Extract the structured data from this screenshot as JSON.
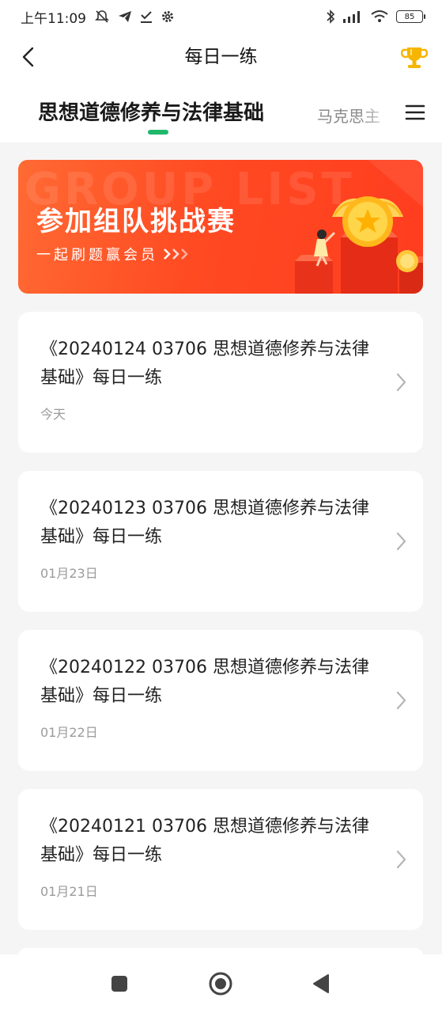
{
  "status_bar": {
    "time": "上午11:09",
    "battery": "85",
    "icons": [
      "alarm-off-icon",
      "telegram-icon",
      "download-check-icon",
      "settings-gear-icon",
      "bluetooth-icon",
      "signal-icon",
      "wifi-icon",
      "battery-icon"
    ]
  },
  "header": {
    "title": "每日一练",
    "back_icon": "chevron-left-icon",
    "trophy_icon": "trophy-icon"
  },
  "tabs": {
    "items": [
      {
        "label": "思想道德修养与法律基础",
        "active": true
      },
      {
        "label": "马克思主",
        "active": false
      }
    ],
    "menu_icon": "menu-icon",
    "accent_color": "#1fb86b"
  },
  "banner": {
    "title": "参加组队挑战赛",
    "subtitle": "一起刷题赢会员",
    "background_text": "GROUP LIST",
    "color": "#ff4a22"
  },
  "practice_list": [
    {
      "title": "《20240124 03706 思想道德修养与法律基础》每日一练",
      "date": "今天"
    },
    {
      "title": "《20240123 03706 思想道德修养与法律基础》每日一练",
      "date": "01月23日"
    },
    {
      "title": "《20240122 03706 思想道德修养与法律基础》每日一练",
      "date": "01月22日"
    },
    {
      "title": "《20240121 03706 思想道德修养与法律基础》每日一练",
      "date": "01月21日"
    }
  ],
  "nav_bar": {
    "icons": [
      "recents-square-icon",
      "home-circle-icon",
      "back-triangle-icon"
    ]
  }
}
